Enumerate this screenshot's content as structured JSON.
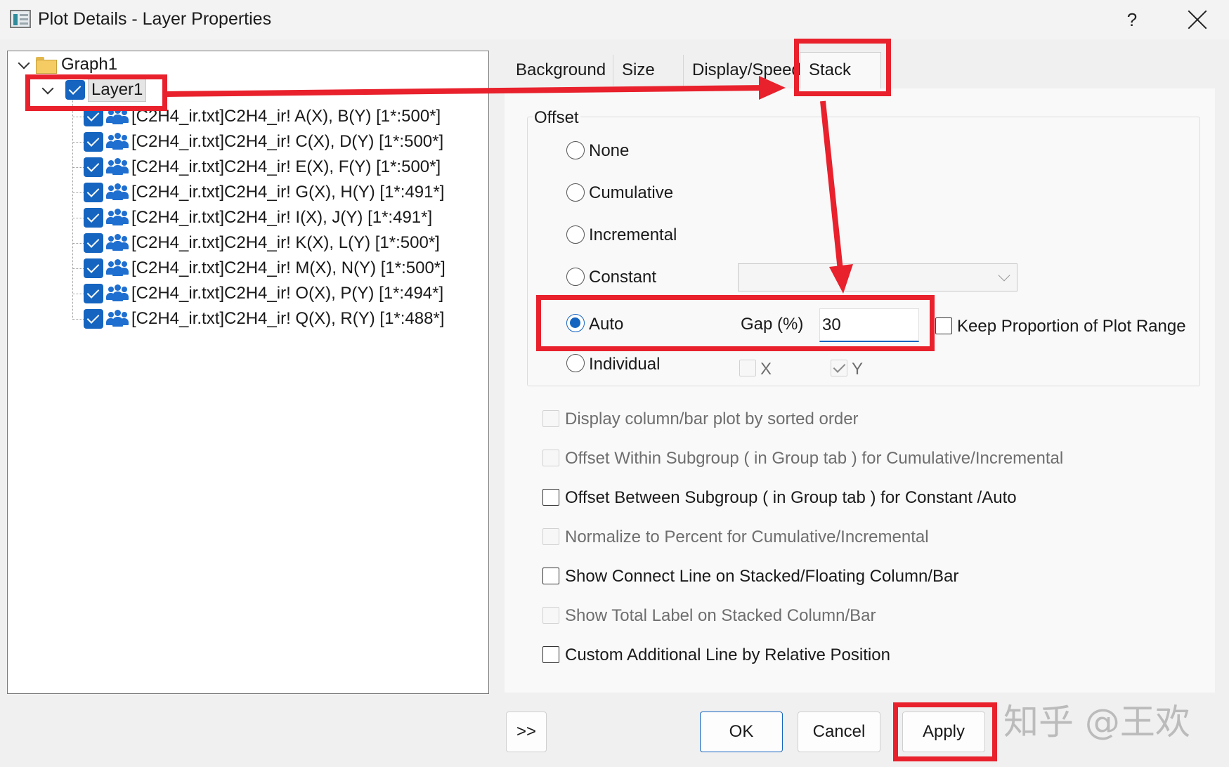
{
  "window": {
    "title": "Plot Details - Layer Properties",
    "help_label": "?"
  },
  "tree": {
    "root": "Graph1",
    "layer": "Layer1",
    "items": [
      "[C2H4_ir.txt]C2H4_ir! A(X), B(Y) [1*:500*]",
      "[C2H4_ir.txt]C2H4_ir! C(X), D(Y) [1*:500*]",
      "[C2H4_ir.txt]C2H4_ir! E(X), F(Y) [1*:500*]",
      "[C2H4_ir.txt]C2H4_ir! G(X), H(Y) [1*:491*]",
      "[C2H4_ir.txt]C2H4_ir! I(X), J(Y) [1*:491*]",
      "[C2H4_ir.txt]C2H4_ir! K(X), L(Y) [1*:500*]",
      "[C2H4_ir.txt]C2H4_ir! M(X), N(Y) [1*:500*]",
      "[C2H4_ir.txt]C2H4_ir! O(X), P(Y) [1*:494*]",
      "[C2H4_ir.txt]C2H4_ir! Q(X), R(Y) [1*:488*]"
    ]
  },
  "tabs": [
    "Background",
    "Size",
    "Display/Speed",
    "Stack"
  ],
  "active_tab": "Stack",
  "offset": {
    "group_label": "Offset",
    "options": [
      "None",
      "Cumulative",
      "Incremental",
      "Constant",
      "Auto",
      "Individual"
    ],
    "selected": "Auto",
    "gap_label": "Gap (%)",
    "gap_value": "30",
    "keep_proportion_label": "Keep Proportion of Plot Range",
    "x_label": "X",
    "y_label": "Y"
  },
  "options": [
    {
      "label": "Display column/bar plot by sorted order",
      "enabled": false,
      "checked": false
    },
    {
      "label": "Offset Within Subgroup ( in Group tab ) for Cumulative/Incremental",
      "enabled": false,
      "checked": false
    },
    {
      "label": "Offset Between Subgroup ( in Group tab ) for Constant /Auto",
      "enabled": true,
      "checked": false
    },
    {
      "label": "Normalize to Percent for Cumulative/Incremental",
      "enabled": false,
      "checked": false
    },
    {
      "label": "Show Connect Line on Stacked/Floating Column/Bar",
      "enabled": true,
      "checked": false
    },
    {
      "label": "Show Total Label on Stacked Column/Bar",
      "enabled": false,
      "checked": false
    },
    {
      "label": "Custom Additional Line by Relative Position",
      "enabled": true,
      "checked": false
    }
  ],
  "buttons": {
    "expand": ">>",
    "ok": "OK",
    "cancel": "Cancel",
    "apply": "Apply"
  },
  "watermark": "知乎 @王欢",
  "colors": {
    "accent": "#1565c0",
    "annotation_red": "#e8212c"
  }
}
